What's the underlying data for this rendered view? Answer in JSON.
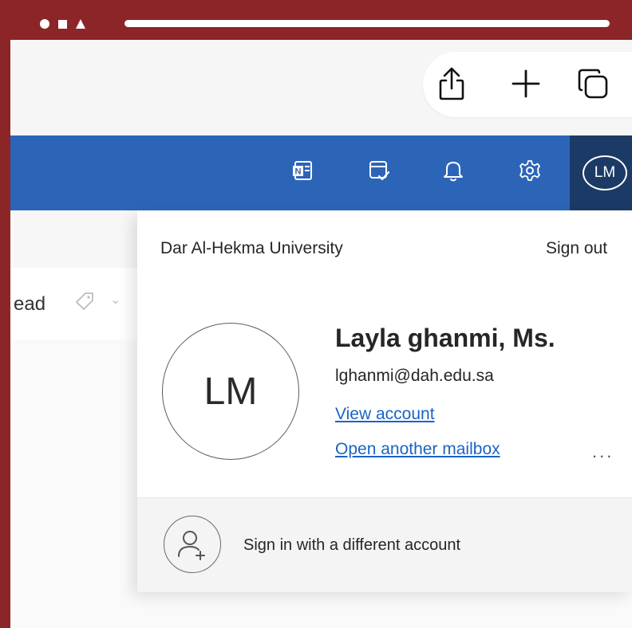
{
  "frame": {
    "color": "#8b2528"
  },
  "toolbar": {
    "icons": [
      "share-icon",
      "plus-icon",
      "tabs-icon"
    ]
  },
  "appbar": {
    "color": "#2c65b8",
    "icons": [
      "onenote-icon",
      "todo-icon",
      "bell-icon",
      "gear-icon"
    ],
    "avatar_initials": "LM"
  },
  "background": {
    "read_text": "ead"
  },
  "account": {
    "organization": "Dar Al-Hekma University",
    "sign_out": "Sign out",
    "initials": "LM",
    "name": "Layla ghanmi, Ms.",
    "email": "lghanmi@dah.edu.sa",
    "view_account": "View account",
    "open_mailbox": "Open another mailbox",
    "more": "...",
    "sign_in_different": "Sign in with a different account",
    "link_color": "#1a64c4"
  }
}
